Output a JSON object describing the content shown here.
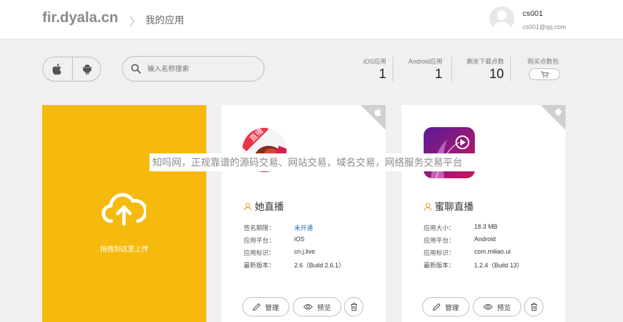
{
  "header": {
    "logo": "fir.dyala.cn",
    "breadcrumb_sep": "〉",
    "breadcrumb": "我的应用",
    "user": {
      "name": "cs001",
      "email": "cs001@qq.com"
    }
  },
  "toolbar": {
    "search_placeholder": "输入名称搜索",
    "stats": [
      {
        "label": "iOS应用",
        "value": "1"
      },
      {
        "label": "Android应用",
        "value": "1"
      },
      {
        "label": "剩余下载点数",
        "value": "10"
      }
    ],
    "buy_label": "购买点数包"
  },
  "upload": {
    "label": "拖拽到这里上传"
  },
  "apps": [
    {
      "name": "她直播",
      "platform_icon": "apple-icon",
      "rows": [
        {
          "k": "签名期限：",
          "v": "未开通"
        },
        {
          "k": "应用平台：",
          "v": "iOS"
        },
        {
          "k": "应用标识：",
          "v": "cn.j.live"
        },
        {
          "k": "最新版本：",
          "v": "2.6（Build 2.6.1）"
        }
      ],
      "status_color": "#1a6bb0",
      "actions": {
        "manage": "管理",
        "preview": "预览"
      }
    },
    {
      "name": "蜜聊直播",
      "platform_icon": "android-icon",
      "rows": [
        {
          "k": "应用大小：",
          "v": "18.3 MB"
        },
        {
          "k": "应用平台：",
          "v": "Android"
        },
        {
          "k": "应用标识：",
          "v": "com.miliao.ui"
        },
        {
          "k": "最新版本：",
          "v": "1.2.4（Build 13）"
        }
      ],
      "actions": {
        "manage": "管理",
        "preview": "预览"
      }
    }
  ],
  "badge": "直播",
  "watermark": "知吗网，正规靠谱的源码交易、网站交易，域名交易，网络服务交易平台",
  "colors": {
    "accent": "#f6b90d",
    "background": "#f0f0f0"
  }
}
